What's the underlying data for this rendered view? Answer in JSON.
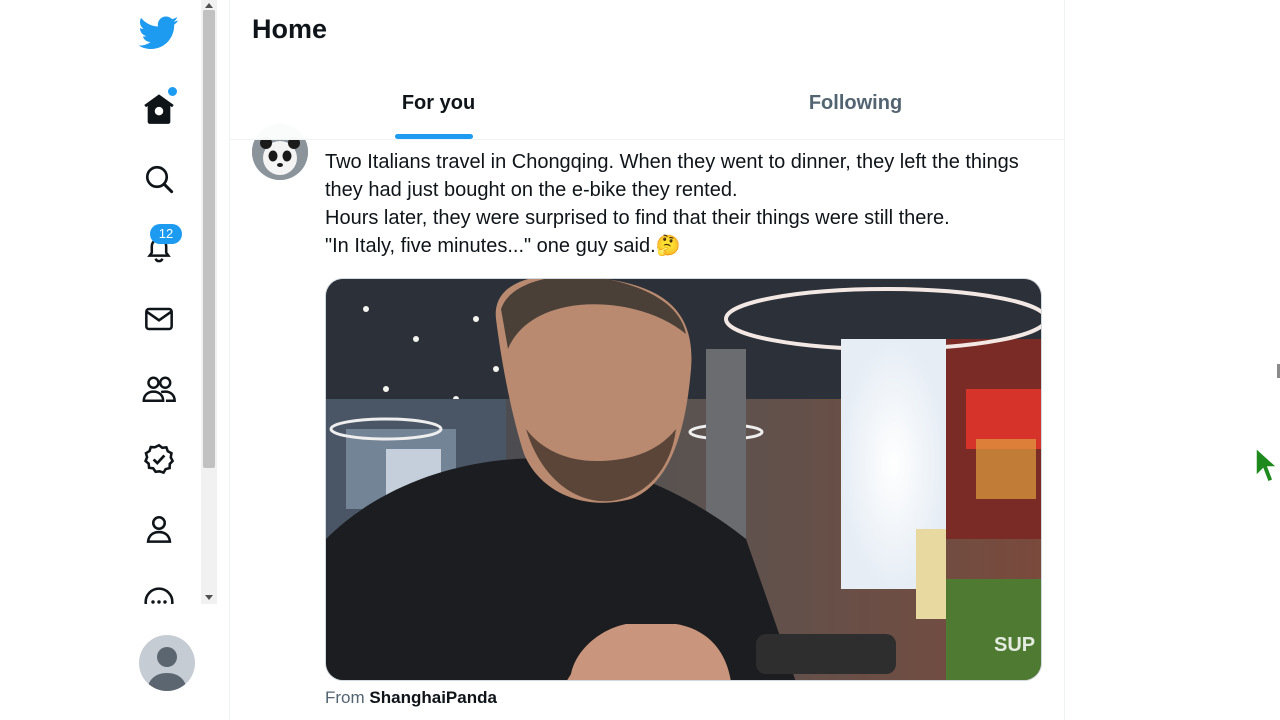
{
  "header": {
    "title": "Home",
    "tabs": [
      {
        "label": "For you",
        "active": true
      },
      {
        "label": "Following",
        "active": false
      }
    ]
  },
  "nav": {
    "items": [
      {
        "name": "twitter-logo-icon"
      },
      {
        "name": "home-icon",
        "has_dot": true
      },
      {
        "name": "search-icon"
      },
      {
        "name": "bell-icon",
        "badge": "12"
      },
      {
        "name": "mail-icon"
      },
      {
        "name": "communities-icon"
      },
      {
        "name": "verified-icon"
      },
      {
        "name": "profile-icon"
      },
      {
        "name": "more-icon"
      }
    ]
  },
  "tweet": {
    "text_lines": [
      "Two Italians travel in Chongqing. When they went to dinner, they left the things they had just bought on the e-bike they rented.",
      "Hours later, they were surprised to find that their things were still there.",
      "\"In Italy, five minutes...\" one guy said.🤔"
    ],
    "from_prefix": "From",
    "from_name": "ShanghaiPanda",
    "media_watermark": "SUP"
  },
  "colors": {
    "accent": "#1d9bf0",
    "text": "#0f1419",
    "secondary_text": "#536471",
    "cursor": "#1e8a1e"
  }
}
